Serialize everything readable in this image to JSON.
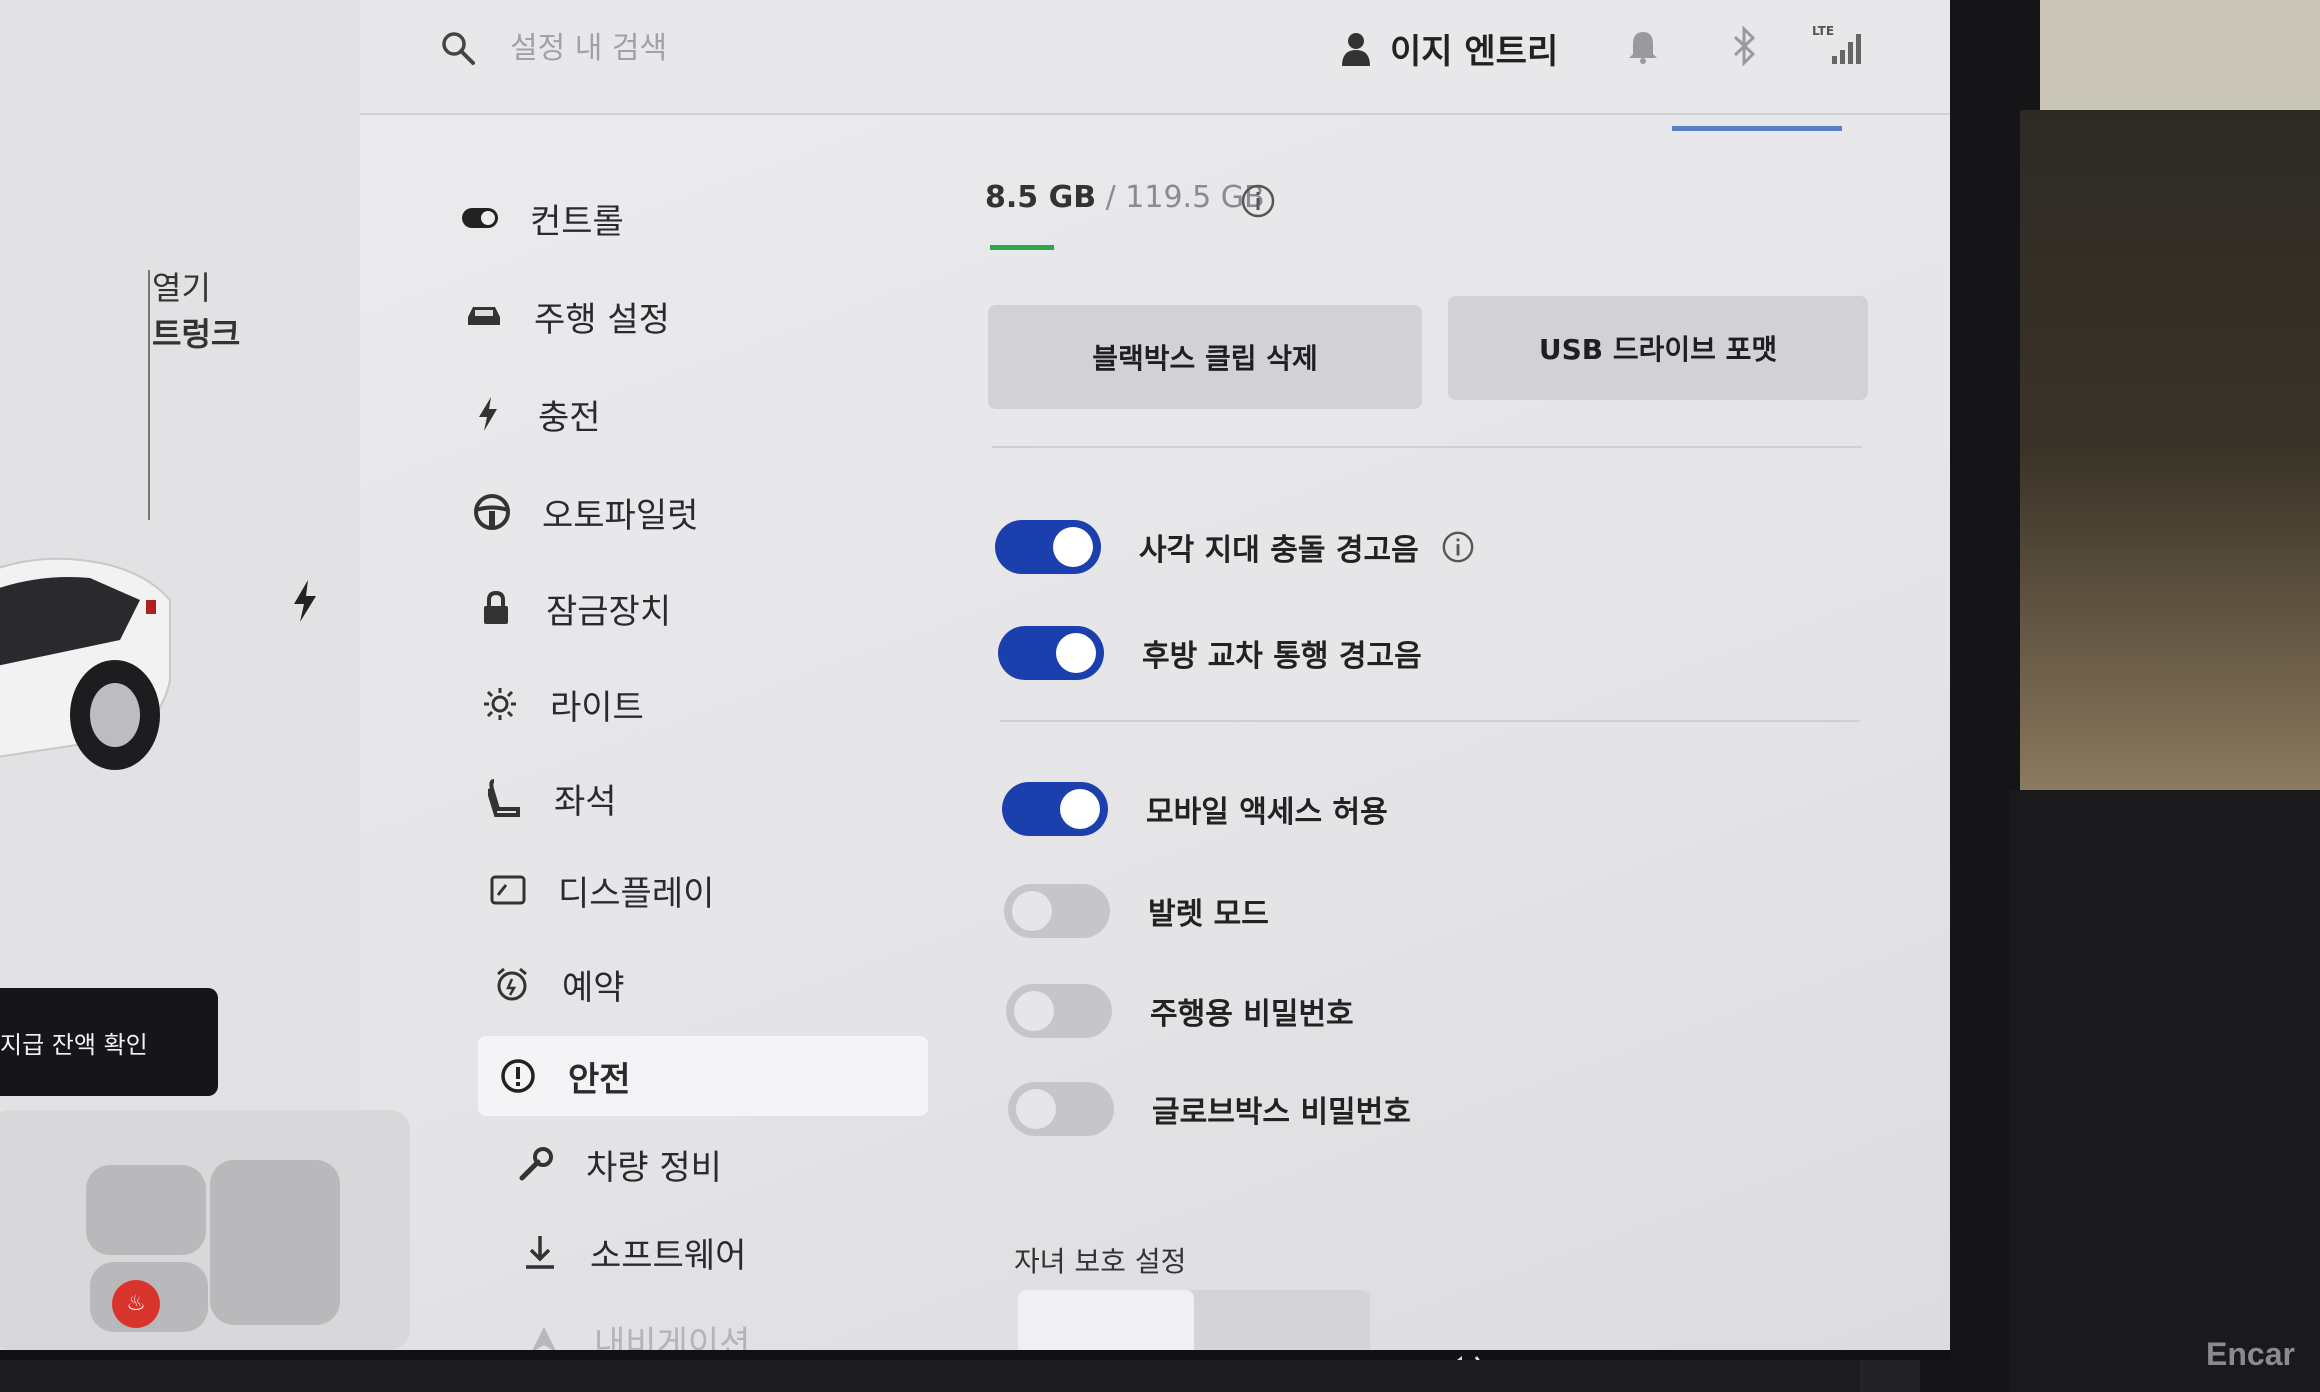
{
  "search": {
    "placeholder": "설정 내 검색"
  },
  "profile": {
    "name": "이지 엔트리"
  },
  "status": {
    "network": "LTE"
  },
  "car_panel": {
    "trunk_label_line1": "열기",
    "trunk_label_line2": "트렁크",
    "balance_button": "지급 잔액 확인"
  },
  "menu": {
    "items": [
      {
        "label": "컨트롤",
        "icon": "toggle-icon"
      },
      {
        "label": "주행 설정",
        "icon": "car-icon"
      },
      {
        "label": "충전",
        "icon": "bolt-icon"
      },
      {
        "label": "오토파일럿",
        "icon": "steering-wheel-icon"
      },
      {
        "label": "잠금장치",
        "icon": "lock-icon"
      },
      {
        "label": "라이트",
        "icon": "sun-icon"
      },
      {
        "label": "좌석",
        "icon": "seat-icon"
      },
      {
        "label": "디스플레이",
        "icon": "display-icon"
      },
      {
        "label": "예약",
        "icon": "alarm-clock-icon"
      },
      {
        "label": "안전",
        "icon": "alert-circle-icon"
      },
      {
        "label": "차량 정비",
        "icon": "wrench-icon"
      },
      {
        "label": "소프트웨어",
        "icon": "download-icon"
      },
      {
        "label": "내비게이션",
        "icon": "navigation-icon"
      }
    ],
    "active": "안전"
  },
  "storage": {
    "used": "8.5 GB",
    "total": " / 119.5 GB"
  },
  "buttons": {
    "delete_clips": "블랙박스 클립 삭제",
    "format_usb": "USB 드라이브 포맷"
  },
  "toggles": [
    {
      "label": "사각 지대 충돌 경고음",
      "on": true,
      "info": true
    },
    {
      "label": "후방 교차 통행 경고음",
      "on": true,
      "info": false
    },
    {
      "label": "모바일 액세스 허용",
      "on": true,
      "info": false
    },
    {
      "label": "발렛 모드",
      "on": false,
      "info": false
    },
    {
      "label": "주행용 비밀번호",
      "on": false,
      "info": false
    },
    {
      "label": "글로브박스 비밀번호",
      "on": false,
      "info": false
    }
  ],
  "kids": {
    "heading": "자녀 보호 설정"
  },
  "watermark": "Encar",
  "colors": {
    "toggle_on": "#1c3fae",
    "storage_bar": "#2aa84a",
    "active_menu_bg": "#f4f4f6"
  }
}
